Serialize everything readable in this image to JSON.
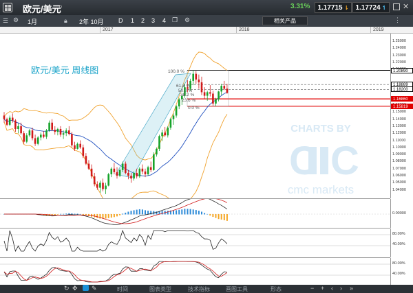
{
  "app": {
    "symbol": "欧元/美元",
    "change": "3.31%",
    "sell_price": "1.17715",
    "buy_price": "1.17724"
  },
  "toolbar": {
    "interval": "1月",
    "range": "2年 10月",
    "period_btns": [
      "D",
      "1",
      "2",
      "3",
      "4"
    ],
    "related_label": "相关产品"
  },
  "chart": {
    "title": "欧元/美元 周线图",
    "watermark_line1": "CHARTS BY",
    "watermark_line2": "cmc markets",
    "x_labels": [
      "2017",
      "2018",
      "2019"
    ],
    "y_ticks": [
      "1.25000",
      "1.24000",
      "1.23000",
      "1.22000",
      "1.21000",
      "1.19000",
      "1.17000",
      "1.16000",
      "1.15000",
      "1.14000",
      "1.13000",
      "1.12000",
      "1.11000",
      "1.10000",
      "1.09000",
      "1.08000",
      "1.07000",
      "1.06000",
      "1.05000",
      "1.04000",
      "1.03000"
    ],
    "price_tags": [
      {
        "value": "1.20890",
        "color": "#000000"
      },
      {
        "value": "1.18889",
        "color": "#000000"
      },
      {
        "value": "1.18200",
        "color": "#000000"
      },
      {
        "value": "1.16860",
        "color": "#e00000"
      },
      {
        "value": "1.15819",
        "color": "#e00000"
      }
    ],
    "fib_labels": [
      "100.0 %",
      "61.8 %",
      "50.0 %",
      "38.2 %",
      "23.6 %",
      "0.0 %"
    ],
    "macd_tick": "0.00000",
    "osc1_ticks": [
      "80.00%",
      "40.00%"
    ],
    "osc2_ticks": [
      "80.00%",
      "40.00%"
    ]
  },
  "bottom": {
    "tabs": [
      "时间",
      "图表类型",
      "技术指标",
      "画图工具",
      "形态"
    ]
  },
  "chart_data": {
    "type": "candlestick",
    "title": "欧元/美元 周线图",
    "ylim": [
      1.03,
      1.255
    ],
    "candles": [
      [
        1.145,
        1.15,
        1.135,
        1.14
      ],
      [
        1.14,
        1.142,
        1.13,
        1.132
      ],
      [
        1.132,
        1.145,
        1.13,
        1.142
      ],
      [
        1.142,
        1.148,
        1.135,
        1.138
      ],
      [
        1.138,
        1.14,
        1.122,
        1.126
      ],
      [
        1.126,
        1.134,
        1.12,
        1.13
      ],
      [
        1.13,
        1.135,
        1.118,
        1.12
      ],
      [
        1.12,
        1.123,
        1.105,
        1.108
      ],
      [
        1.108,
        1.12,
        1.106,
        1.117
      ],
      [
        1.117,
        1.126,
        1.115,
        1.124
      ],
      [
        1.124,
        1.128,
        1.11,
        1.113
      ],
      [
        1.113,
        1.118,
        1.102,
        1.105
      ],
      [
        1.105,
        1.116,
        1.103,
        1.114
      ],
      [
        1.114,
        1.121,
        1.11,
        1.118
      ],
      [
        1.118,
        1.123,
        1.113,
        1.115
      ],
      [
        1.115,
        1.126,
        1.112,
        1.124
      ],
      [
        1.124,
        1.138,
        1.122,
        1.135
      ],
      [
        1.135,
        1.14,
        1.123,
        1.125
      ],
      [
        1.125,
        1.13,
        1.118,
        1.122
      ],
      [
        1.122,
        1.128,
        1.117,
        1.126
      ],
      [
        1.126,
        1.13,
        1.115,
        1.118
      ],
      [
        1.118,
        1.124,
        1.112,
        1.12
      ],
      [
        1.12,
        1.127,
        1.116,
        1.124
      ],
      [
        1.124,
        1.13,
        1.117,
        1.119
      ],
      [
        1.119,
        1.122,
        1.1,
        1.103
      ],
      [
        1.103,
        1.108,
        1.095,
        1.098
      ],
      [
        1.098,
        1.107,
        1.097,
        1.105
      ],
      [
        1.105,
        1.11,
        1.098,
        1.1
      ],
      [
        1.1,
        1.104,
        1.085,
        1.088
      ],
      [
        1.088,
        1.092,
        1.075,
        1.077
      ],
      [
        1.077,
        1.082,
        1.068,
        1.07
      ],
      [
        1.07,
        1.076,
        1.056,
        1.059
      ],
      [
        1.059,
        1.064,
        1.045,
        1.048
      ],
      [
        1.048,
        1.052,
        1.04,
        1.043
      ],
      [
        1.043,
        1.053,
        1.036,
        1.05
      ],
      [
        1.05,
        1.056,
        1.038,
        1.041
      ],
      [
        1.041,
        1.05,
        1.034,
        1.046
      ],
      [
        1.046,
        1.064,
        1.045,
        1.062
      ],
      [
        1.062,
        1.072,
        1.058,
        1.07
      ],
      [
        1.07,
        1.078,
        1.062,
        1.065
      ],
      [
        1.065,
        1.072,
        1.056,
        1.06
      ],
      [
        1.06,
        1.07,
        1.058,
        1.068
      ],
      [
        1.068,
        1.08,
        1.065,
        1.077
      ],
      [
        1.077,
        1.08,
        1.062,
        1.064
      ],
      [
        1.064,
        1.068,
        1.055,
        1.06
      ],
      [
        1.06,
        1.064,
        1.05,
        1.056
      ],
      [
        1.056,
        1.066,
        1.053,
        1.064
      ],
      [
        1.064,
        1.07,
        1.056,
        1.059
      ],
      [
        1.059,
        1.072,
        1.057,
        1.07
      ],
      [
        1.07,
        1.076,
        1.062,
        1.066
      ],
      [
        1.066,
        1.07,
        1.058,
        1.062
      ],
      [
        1.062,
        1.074,
        1.06,
        1.072
      ],
      [
        1.072,
        1.08,
        1.065,
        1.068
      ],
      [
        1.068,
        1.093,
        1.067,
        1.09
      ],
      [
        1.09,
        1.1,
        1.087,
        1.098
      ],
      [
        1.098,
        1.118,
        1.095,
        1.116
      ],
      [
        1.116,
        1.125,
        1.109,
        1.121
      ],
      [
        1.121,
        1.129,
        1.115,
        1.117
      ],
      [
        1.117,
        1.13,
        1.114,
        1.128
      ],
      [
        1.128,
        1.142,
        1.125,
        1.14
      ],
      [
        1.14,
        1.148,
        1.132,
        1.145
      ],
      [
        1.145,
        1.16,
        1.142,
        1.158
      ],
      [
        1.158,
        1.17,
        1.154,
        1.168
      ],
      [
        1.168,
        1.175,
        1.16,
        1.173
      ],
      [
        1.173,
        1.19,
        1.17,
        1.185
      ],
      [
        1.185,
        1.195,
        1.178,
        1.183
      ],
      [
        1.183,
        1.197,
        1.18,
        1.194
      ],
      [
        1.194,
        1.209,
        1.188,
        1.204
      ],
      [
        1.204,
        1.208,
        1.19,
        1.196
      ],
      [
        1.196,
        1.203,
        1.183,
        1.192
      ],
      [
        1.192,
        1.2,
        1.174,
        1.178
      ],
      [
        1.178,
        1.185,
        1.168,
        1.173
      ],
      [
        1.173,
        1.18,
        1.166,
        1.178
      ],
      [
        1.178,
        1.188,
        1.172,
        1.176
      ],
      [
        1.176,
        1.18,
        1.159,
        1.162
      ],
      [
        1.162,
        1.17,
        1.158,
        1.168
      ],
      [
        1.168,
        1.18,
        1.165,
        1.179
      ],
      [
        1.179,
        1.19,
        1.174,
        1.187
      ],
      [
        1.187,
        1.194,
        1.181,
        1.183
      ],
      [
        1.183,
        1.19,
        1.176,
        1.177
      ]
    ]
  }
}
